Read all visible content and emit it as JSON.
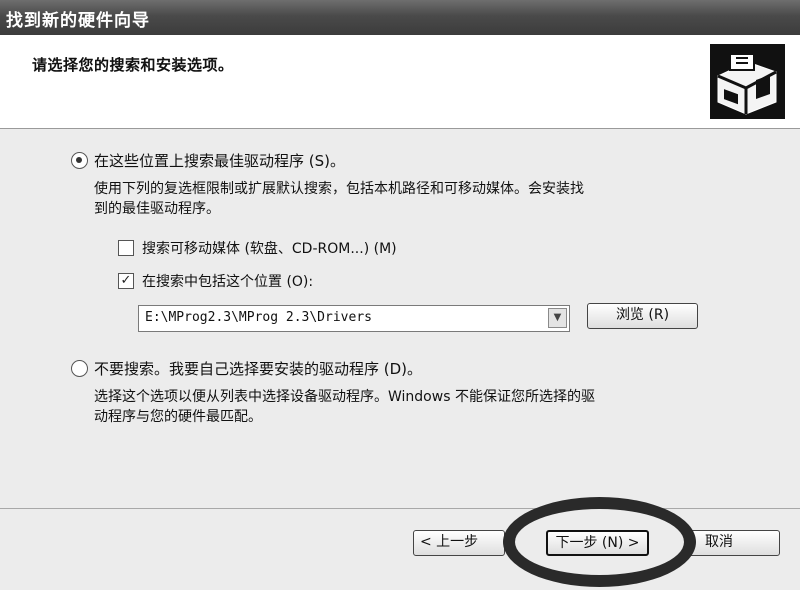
{
  "window": {
    "title": "找到新的硬件向导"
  },
  "header": {
    "heading": "请选择您的搜索和安装选项。",
    "icon": "hardware-wizard-icon"
  },
  "options": {
    "search": {
      "label": "在这些位置上搜索最佳驱动程序 (S)。",
      "checked": true,
      "description_line1": "使用下列的复选框限制或扩展默认搜索，包括本机路径和可移动媒体。会安装找",
      "description_line2": "到的最佳驱动程序。",
      "removable_media": {
        "label": "搜索可移动媒体 (软盘、CD-ROM...) (M)",
        "checked": false
      },
      "include_location": {
        "label": "在搜索中包括这个位置 (O):",
        "checked": true
      },
      "location_value": "E:\\MProg2.3\\MProg 2.3\\Drivers",
      "browse_label": "浏览 (R)"
    },
    "manual": {
      "label": "不要搜索。我要自己选择要安装的驱动程序 (D)。",
      "checked": false,
      "description_line1": "选择这个选项以便从列表中选择设备驱动程序。Windows 不能保证您所选择的驱",
      "description_line2": "动程序与您的硬件最匹配。"
    }
  },
  "buttons": {
    "back": "< 上一步",
    "next": "下一步 (N) >",
    "cancel": "取消"
  },
  "colors": {
    "titlebar": "#4a4a4a",
    "content_bg": "#ececec",
    "highlight_ellipse": "#2a2a2a"
  }
}
